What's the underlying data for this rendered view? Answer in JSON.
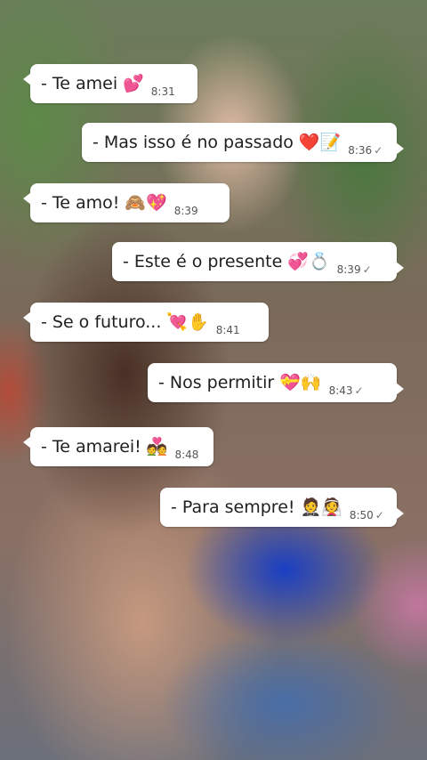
{
  "messages": [
    {
      "text": "- Te amei",
      "emoji": "💕",
      "time": "8:31",
      "side": "in",
      "read_mark": ""
    },
    {
      "text": "- Mas isso é no passado",
      "emoji": "❤️📝",
      "time": "8:36",
      "side": "out",
      "read_mark": "✓"
    },
    {
      "text": "-  Te amo!",
      "emoji": "🙈💖",
      "time": "8:39",
      "side": "in",
      "read_mark": ""
    },
    {
      "text": "- Este é o presente",
      "emoji": "💞💍",
      "time": "8:39",
      "side": "out",
      "read_mark": "✓"
    },
    {
      "text": "-  Se o futuro...",
      "emoji": "💘✋",
      "time": "8:41",
      "side": "in",
      "read_mark": ""
    },
    {
      "text": "-  Nos permitir",
      "emoji": "💝🙌",
      "time": "8:43",
      "side": "out",
      "read_mark": "✓"
    },
    {
      "text": "- Te amarei!",
      "emoji": "💑",
      "time": "8:48",
      "side": "in",
      "read_mark": ""
    },
    {
      "text": "- Para sempre!",
      "emoji": "🤵👰",
      "time": "8:50",
      "side": "out",
      "read_mark": "✓"
    }
  ]
}
